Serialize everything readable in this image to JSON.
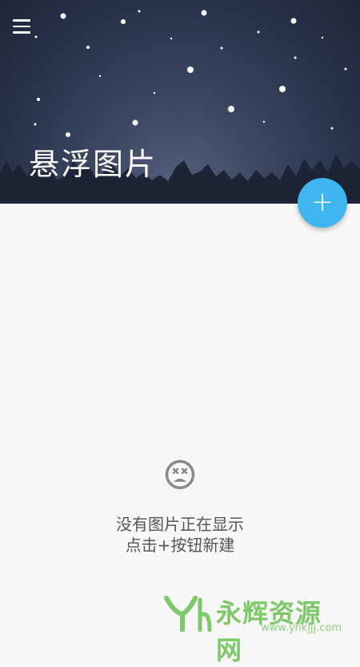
{
  "header": {
    "title": "悬浮图片",
    "menu_icon": "hamburger-menu-icon",
    "background": "night-sky-with-snow-and-pine-forest"
  },
  "fab": {
    "label": "+",
    "color": "#3fb6f0"
  },
  "empty_state": {
    "icon": "sad-face-icon",
    "line1": "没有图片正在显示",
    "line2": "点击+按钮新建"
  },
  "watermark": {
    "text": "永辉资源网",
    "url": "www.yhkjjj.com",
    "color": "#7dc96a"
  }
}
